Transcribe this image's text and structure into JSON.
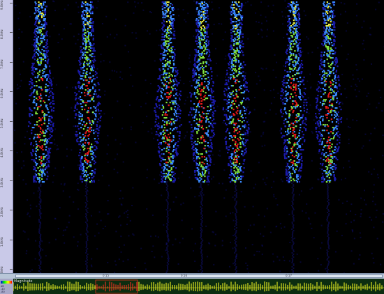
{
  "axis": {
    "ticks": [
      "9.0kHz",
      "8.0kHz",
      "7.0kHz",
      "6.0kHz",
      "5.0kHz",
      "4.0kHz",
      "3.0kHz",
      "2.0kHz",
      "1.0kHz",
      "0.0kHz"
    ]
  },
  "ruler": {
    "labels": [
      "0:15",
      "0:16",
      "0:17"
    ]
  },
  "panel": {
    "magnitude_label": "Magnitude",
    "left_labels": [
      "dB",
      "-40",
      "-80"
    ]
  },
  "colors": {
    "background": "#000000",
    "low": "#1a1aa8",
    "mid": "#3a8aff",
    "green": "#7fe03c",
    "yellow": "#e8ee40",
    "high": "#e01818",
    "wave": "#d8e020",
    "wave_selected": "#e03020"
  },
  "pulses": [
    {
      "center": 0.072
    },
    {
      "center": 0.198
    },
    {
      "center": 0.416
    },
    {
      "center": 0.508
    },
    {
      "center": 0.6
    },
    {
      "center": 0.754
    },
    {
      "center": 0.849
    }
  ]
}
